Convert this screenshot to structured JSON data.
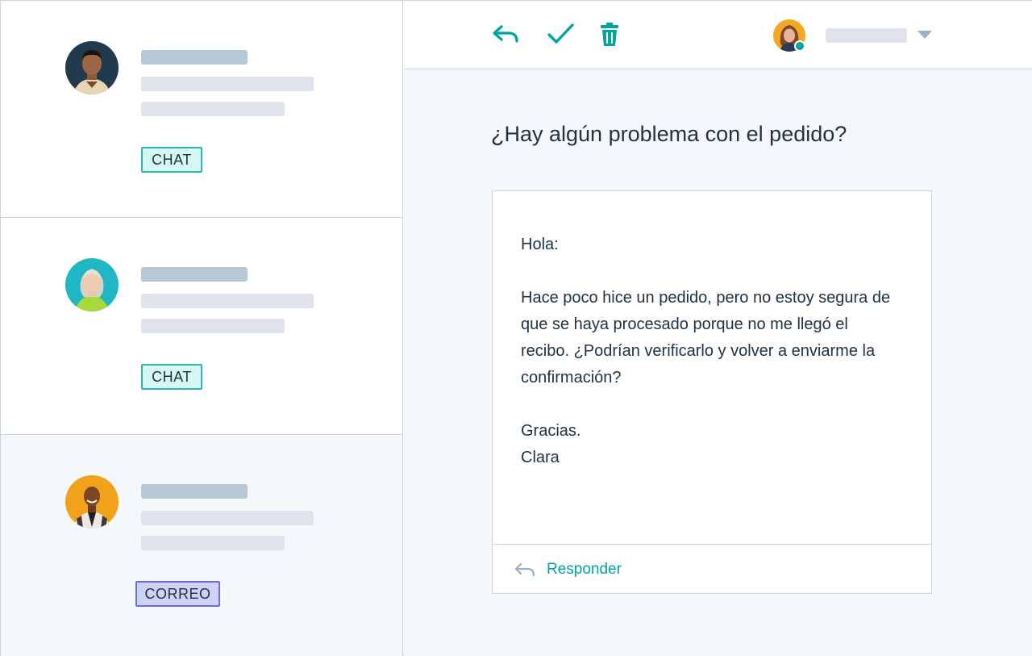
{
  "inbox": {
    "conversations": [
      {
        "channel_tag": "CHAT",
        "avatar": "person-avatar"
      },
      {
        "channel_tag": "CHAT",
        "avatar": "person-avatar"
      },
      {
        "channel_tag": "CORREO",
        "avatar": "person-avatar"
      }
    ]
  },
  "toolbar": {
    "icons": [
      "reply-icon",
      "check-icon",
      "trash-icon",
      "chevron-down-icon"
    ],
    "owner_status": "online"
  },
  "message": {
    "subject": "¿Hay algún problema con el pedido?",
    "greeting": "Hola:",
    "body": "Hace poco hice un pedido, pero no estoy segura de que se haya procesado porque no me llegó el recibo. ¿Podrían verificarlo y volver a enviarme la confirmación?",
    "thanks": "Gracias.",
    "signature": "Clara",
    "reply_label": "Responder"
  },
  "colors": {
    "accent": "#00a4a0",
    "chat_tag_bg": "#d6f8f3",
    "chat_tag_border": "#2bb7aa",
    "mail_tag_bg": "#cfd1f6",
    "mail_tag_border": "#6a6fd6",
    "placeholder_dark": "#b6c7d6",
    "placeholder_light": "#dfe3eb",
    "text": "#213343"
  }
}
